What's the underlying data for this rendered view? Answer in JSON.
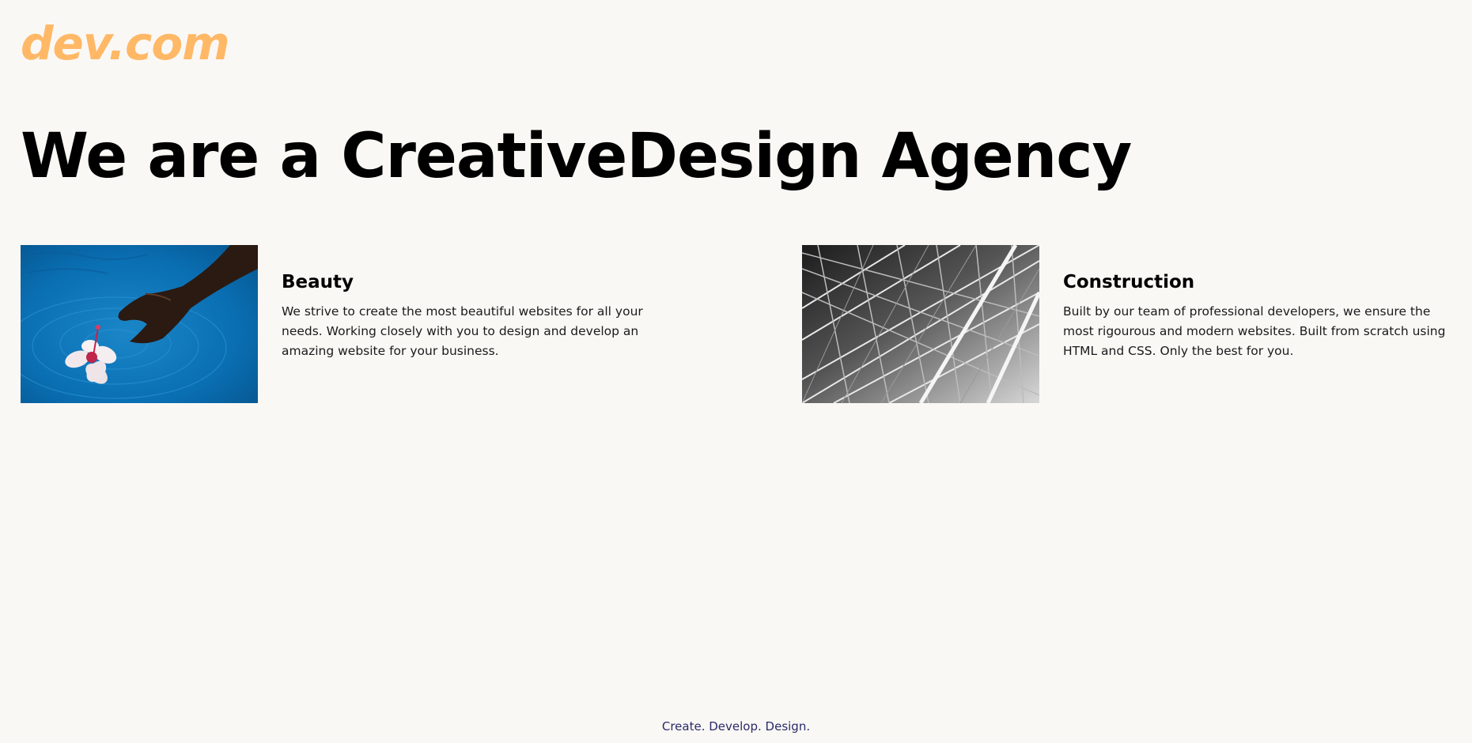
{
  "brand": {
    "logo_text": "dev.com",
    "accent_color": "#ffb866"
  },
  "hero": {
    "title": "We are a CreativeDesign Agency"
  },
  "cards": [
    {
      "title": "Beauty",
      "body": "We strive to create the most beautiful websites for all your needs. Working closely with you to design and develop an amazing website for your business.",
      "image_icon": "hand-touching-flower-in-water-image"
    },
    {
      "title": "Construction",
      "body": "Built by our team of professional developers, we ensure the most rigourous and modern websites. Built from scratch using HTML and CSS. Only the best for you.",
      "image_icon": "steel-truss-structure-image"
    }
  ],
  "footer": {
    "tagline": "Create. Develop. Design."
  }
}
